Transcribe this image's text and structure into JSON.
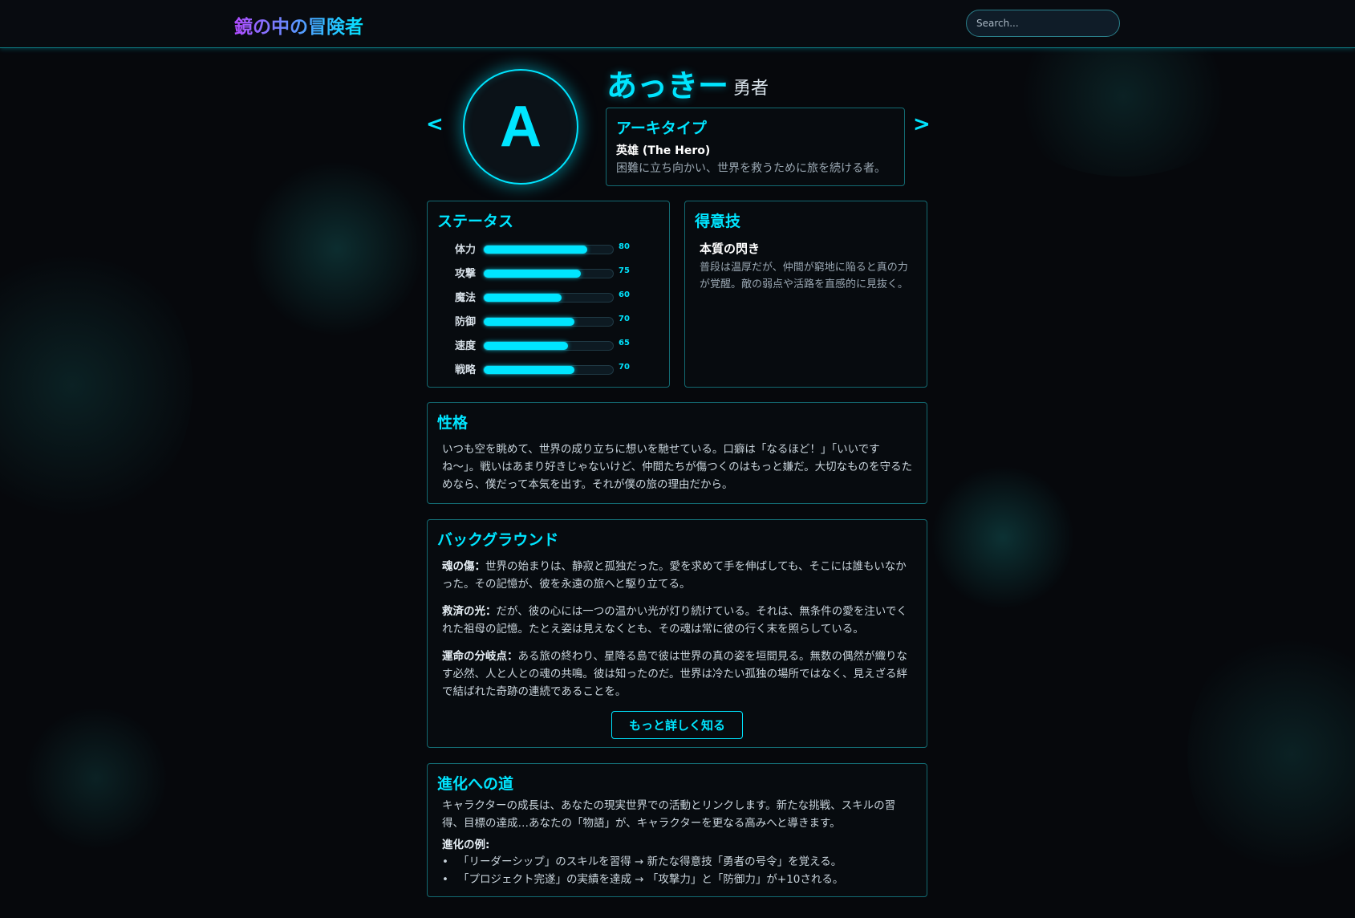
{
  "header": {
    "title": "鏡の中の冒険者",
    "search_placeholder": "Search..."
  },
  "nav": {
    "prev": "<",
    "next": ">"
  },
  "character": {
    "initial": "A",
    "name": "あっきー",
    "class": "勇者"
  },
  "archetype": {
    "heading": "アーキタイプ",
    "name": "英雄 (The Hero)",
    "description": "困難に立ち向かい、世界を救うために旅を続ける者。"
  },
  "status": {
    "heading": "ステータス",
    "stats": [
      {
        "label": "体力",
        "value": 80
      },
      {
        "label": "攻撃",
        "value": 75
      },
      {
        "label": "魔法",
        "value": 60
      },
      {
        "label": "防御",
        "value": 70
      },
      {
        "label": "速度",
        "value": 65
      },
      {
        "label": "戦略",
        "value": 70
      }
    ],
    "max": 100
  },
  "skill": {
    "heading": "得意技",
    "name": "本質の閃き",
    "description": "普段は温厚だが、仲間が窮地に陥ると真の力が覚醒。敵の弱点や活路を直感的に見抜く。"
  },
  "personality": {
    "heading": "性格",
    "text": "いつも空を眺めて、世界の成り立ちに想いを馳せている。口癖は「なるほど！」「いいですね〜」。戦いはあまり好きじゃないけど、仲間たちが傷つくのはもっと嫌だ。大切なものを守るためなら、僕だって本気を出す。それが僕の旅の理由だから。"
  },
  "background": {
    "heading": "バックグラウンド",
    "paragraphs": [
      {
        "label": "魂の傷：",
        "text": "世界の始まりは、静寂と孤独だった。愛を求めて手を伸ばしても、そこには誰もいなかった。その記憶が、彼を永遠の旅へと駆り立てる。"
      },
      {
        "label": "救済の光：",
        "text": "だが、彼の心には一つの温かい光が灯り続けている。それは、無条件の愛を注いでくれた祖母の記憶。たとえ姿は見えなくとも、その魂は常に彼の行く末を照らしている。"
      },
      {
        "label": "運命の分岐点：",
        "text": "ある旅の終わり、星降る島で彼は世界の真の姿を垣間見る。無数の偶然が織りなす必然、人と人との魂の共鳴。彼は知ったのだ。世界は冷たい孤独の場所ではなく、見えざる絆で結ばれた奇跡の連続であることを。"
      }
    ],
    "more_button": "もっと詳しく知る"
  },
  "evolution": {
    "heading": "進化への道",
    "text": "キャラクターの成長は、あなたの現実世界での活動とリンクします。新たな挑戦、スキルの習得、目標の達成…あなたの「物語」が、キャラクターを更なる高みへと導きます。",
    "examples_title": "進化の例:",
    "examples": [
      "「リーダーシップ」のスキルを習得 → 新たな得意技「勇者の号令」を覚える。",
      "「プロジェクト完遂」の実績を達成 → 「攻撃力」と「防御力」が+10される。"
    ]
  },
  "colors": {
    "accent": "#00e5ff",
    "background": "#06080c",
    "panel_border": "#136a72",
    "logo_gradient_start": "#b14bff"
  }
}
